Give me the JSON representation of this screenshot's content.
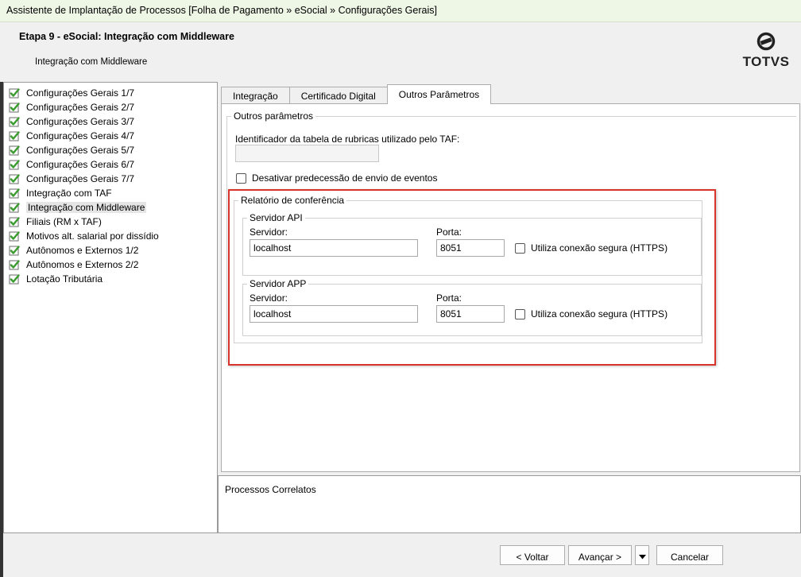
{
  "window": {
    "title": "Assistente de Implantação de Processos [Folha de Pagamento » eSocial » Configurações Gerais]"
  },
  "header": {
    "step_title": "Etapa 9 - eSocial: Integração com Middleware",
    "step_subtitle": "Integração com Middleware",
    "logo_text": "TOTVS"
  },
  "tree": {
    "items": [
      {
        "label": "Configurações Gerais 1/7"
      },
      {
        "label": "Configurações Gerais 2/7"
      },
      {
        "label": "Configurações Gerais 3/7"
      },
      {
        "label": "Configurações Gerais 4/7"
      },
      {
        "label": "Configurações Gerais 5/7"
      },
      {
        "label": "Configurações Gerais 6/7"
      },
      {
        "label": "Configurações Gerais 7/7"
      },
      {
        "label": "Integração com TAF"
      },
      {
        "label": "Integração com Middleware"
      },
      {
        "label": "Filiais (RM x TAF)"
      },
      {
        "label": "Motivos alt. salarial por dissídio"
      },
      {
        "label": "Autônomos e Externos 1/2"
      },
      {
        "label": "Autônomos e Externos 2/2"
      },
      {
        "label": "Lotação Tributária"
      }
    ],
    "selected_index": 8
  },
  "tabs": [
    {
      "label": "Integração"
    },
    {
      "label": "Certificado Digital"
    },
    {
      "label": "Outros Parâmetros"
    }
  ],
  "active_tab": 2,
  "outros": {
    "legend": "Outros parâmetros",
    "rubricas_label": "Identificador da tabela de rubricas utilizado pelo TAF:",
    "rubricas_value": "",
    "desativar_label": "Desativar predecessão de envio de eventos",
    "desativar_checked": false
  },
  "relatorio": {
    "legend": "Relatório de conferência",
    "api": {
      "legend": "Servidor API",
      "servidor_label": "Servidor:",
      "servidor_value": "localhost",
      "porta_label": "Porta:",
      "porta_value": "8051",
      "https_label": "Utiliza conexão segura (HTTPS)",
      "https_checked": false
    },
    "app": {
      "legend": "Servidor APP",
      "servidor_label": "Servidor:",
      "servidor_value": "localhost",
      "porta_label": "Porta:",
      "porta_value": "8051",
      "https_label": "Utiliza conexão segura (HTTPS)",
      "https_checked": false
    }
  },
  "related": {
    "label": "Processos Correlatos"
  },
  "buttons": {
    "back": "< Voltar",
    "next": "Avançar >",
    "cancel": "Cancelar"
  },
  "colors": {
    "highlight": "#d9342b",
    "check_green": "#3a9b2e"
  }
}
